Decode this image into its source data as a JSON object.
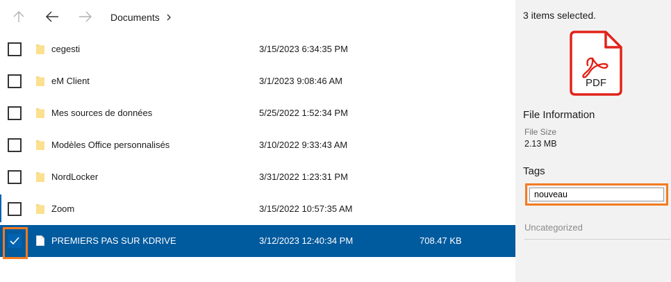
{
  "nav": {
    "up_icon": "arrow-up-icon",
    "back_icon": "arrow-left-icon",
    "forward_icon": "arrow-right-icon",
    "breadcrumb": "Documents",
    "chevron_icon": "chevron-right-icon"
  },
  "files": [
    {
      "name": "cegesti",
      "date": "3/15/2023 6:34:35 PM",
      "size": "",
      "type": "folder",
      "checked": false
    },
    {
      "name": "eM Client",
      "date": "3/1/2023 9:08:46 AM",
      "size": "",
      "type": "folder",
      "checked": false
    },
    {
      "name": "Mes sources de données",
      "date": "5/25/2022 1:52:34 PM",
      "size": "",
      "type": "folder",
      "checked": false
    },
    {
      "name": "Modèles Office personnalisés",
      "date": "3/10/2022 9:33:43 AM",
      "size": "",
      "type": "folder",
      "checked": false
    },
    {
      "name": "NordLocker",
      "date": "3/31/2022 1:23:31 PM",
      "size": "",
      "type": "folder",
      "checked": false
    },
    {
      "name": "Zoom",
      "date": "3/15/2022 10:57:35 AM",
      "size": "",
      "type": "folder",
      "checked": false
    },
    {
      "name": "PREMIERS PAS SUR KDRIVE",
      "date": "3/12/2023 12:40:34 PM",
      "size": "708.47 KB",
      "type": "file",
      "checked": true
    }
  ],
  "details": {
    "selection_text": "3 items selected.",
    "preview_icon": "pdf-file-icon",
    "preview_label": "PDF",
    "info_title": "File Information",
    "size_label": "File Size",
    "size_value": "2.13 MB",
    "tags_title": "Tags",
    "tags_value": "nouveau",
    "category": "Uncategorized"
  },
  "colors": {
    "selection": "#005a9e",
    "checkbox_checked": "#0063b1",
    "highlight": "#f47b20",
    "pdf_red": "#e2231a",
    "folder": "#f8d775",
    "panel_bg": "#f2f2f2"
  }
}
